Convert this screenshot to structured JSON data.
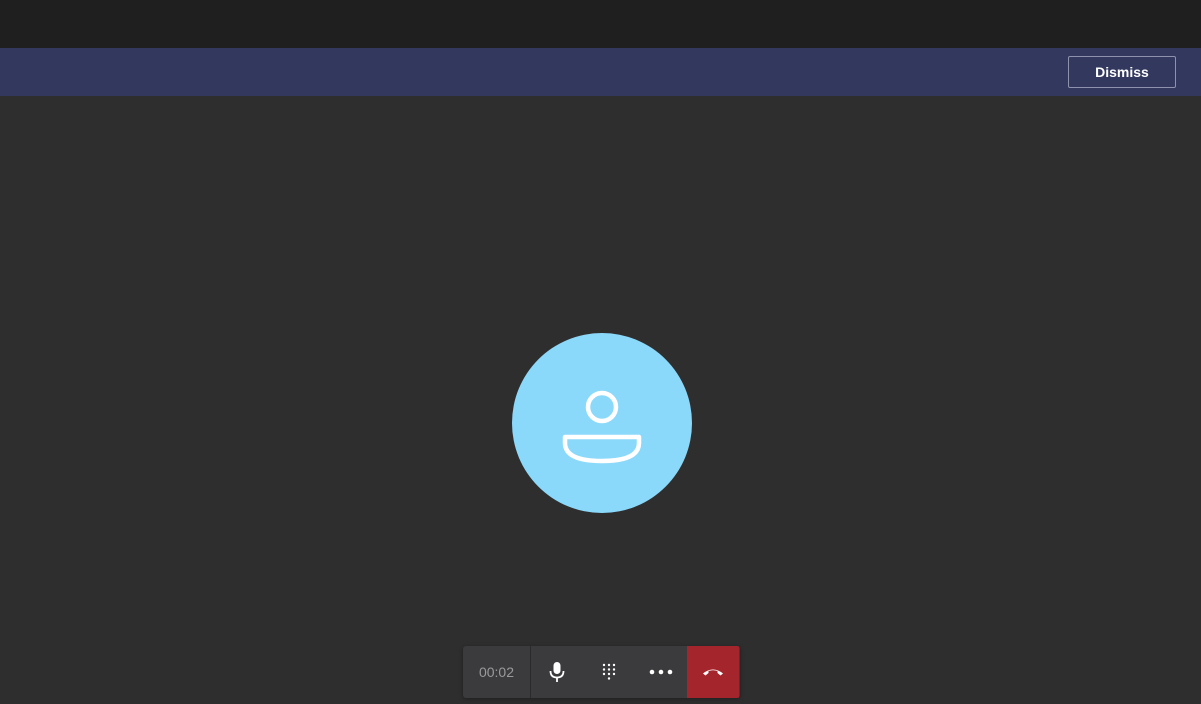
{
  "banner": {
    "dismiss_label": "Dismiss"
  },
  "call": {
    "duration": "00:02",
    "avatar_color": "#8bd9fa",
    "hangup_color": "#a4262c"
  },
  "controls": {
    "icons": [
      "microphone-icon",
      "dialpad-icon",
      "more-options-icon",
      "hang-up-icon"
    ]
  }
}
